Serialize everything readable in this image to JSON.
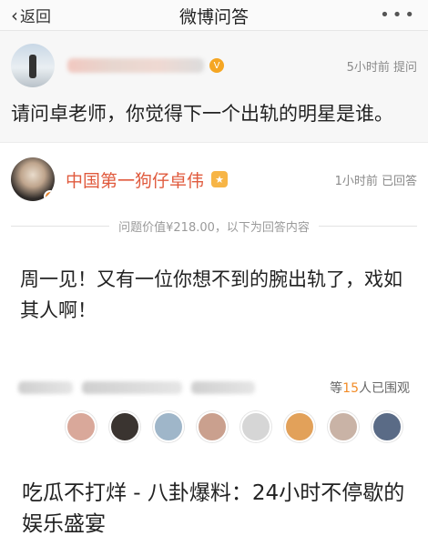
{
  "header": {
    "back_label": "返回",
    "title": "微博问答",
    "more_label": "•••"
  },
  "question": {
    "meta": "5小时前 提问",
    "text": "请问卓老师，你觉得下一个出轨的明星是谁。"
  },
  "answer": {
    "author": "中国第一狗仔卓伟",
    "meta": "1小时前 已回答",
    "price_line": "问题价值¥218.00，以下为回答内容",
    "text": "周一见！又有一位你想不到的腕出轨了，戏如其人啊！"
  },
  "viewers": {
    "prefix": "等",
    "count": "15",
    "suffix": "人已围观"
  },
  "face_colors": [
    "#d9a89a",
    "#3a3430",
    "#9fb6c9",
    "#caa08e",
    "#d6d6d6",
    "#e2a15a",
    "#c9b3a6",
    "#5a6b86"
  ],
  "caption": "吃瓜不打烊 - 八卦爆料：24小时不停歇的娱乐盛宴",
  "colors": {
    "accent_name": "#e05a3d",
    "viewer_count": "#f28c28"
  }
}
